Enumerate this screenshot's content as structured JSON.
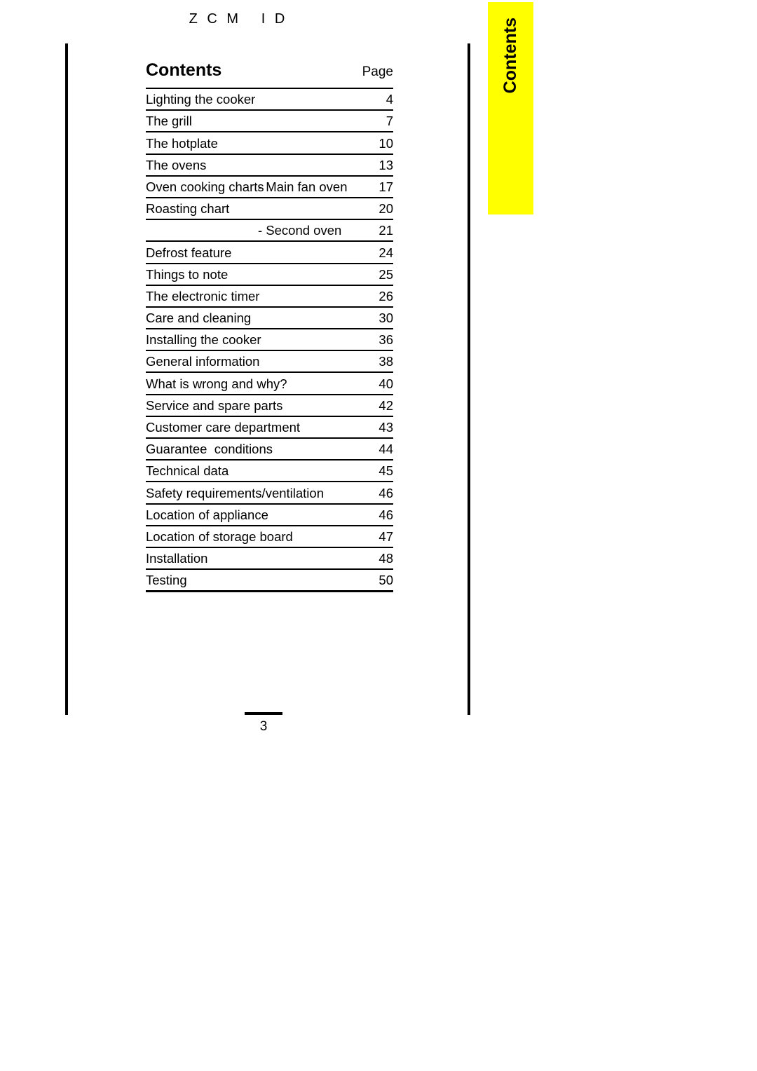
{
  "header": {
    "running_title": "Z C M   I D"
  },
  "tab": {
    "label": "Contents",
    "color": "#ffff00"
  },
  "contents": {
    "title": "Contents",
    "page_column_label": "Page",
    "rows": [
      {
        "title": "Lighting the cooker",
        "sub": "",
        "page": "4"
      },
      {
        "title": "The grill",
        "sub": "",
        "page": "7"
      },
      {
        "title": "The hotplate",
        "sub": "",
        "page": "10"
      },
      {
        "title": "The ovens",
        "sub": "",
        "page": "13"
      },
      {
        "title": "Oven cooking charts",
        "sub": "- Main fan oven",
        "page": "17"
      },
      {
        "title": "Roasting chart",
        "sub": "",
        "page": "20"
      },
      {
        "title": "",
        "sub": "- Second oven",
        "page": "21"
      },
      {
        "title": "Defrost feature",
        "sub": "",
        "page": "24"
      },
      {
        "title": "Things to note",
        "sub": "",
        "page": "25"
      },
      {
        "title": "The electronic timer",
        "sub": "",
        "page": "26"
      },
      {
        "title": "Care and cleaning",
        "sub": "",
        "page": "30"
      },
      {
        "title": "Installing the cooker",
        "sub": "",
        "page": "36"
      },
      {
        "title": "General information",
        "sub": "",
        "page": "38"
      },
      {
        "title": "What is wrong and why?",
        "sub": "",
        "page": "40"
      },
      {
        "title": "Service and spare parts",
        "sub": "",
        "page": "42"
      },
      {
        "title": "Customer care department",
        "sub": "",
        "page": "43"
      },
      {
        "title": "Guarantee  conditions",
        "sub": "",
        "page": "44"
      },
      {
        "title": "Technical data",
        "sub": "",
        "page": "45"
      },
      {
        "title": "Safety requirements/ventilation",
        "sub": "",
        "page": "46"
      },
      {
        "title": "Location of appliance",
        "sub": "",
        "page": "46"
      },
      {
        "title": "Location of storage board",
        "sub": "",
        "page": "47"
      },
      {
        "title": "Installation",
        "sub": "",
        "page": "48"
      },
      {
        "title": "Testing",
        "sub": "",
        "page": "50"
      }
    ]
  },
  "footer": {
    "page_number": "3"
  }
}
